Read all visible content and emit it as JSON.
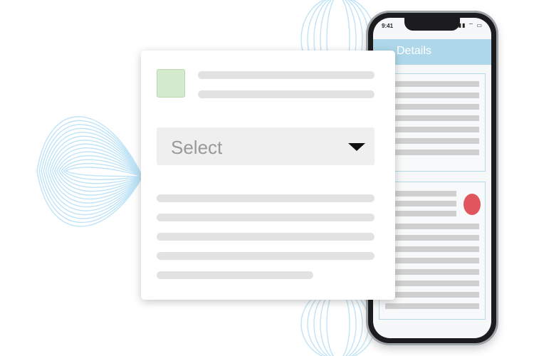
{
  "phone": {
    "status_time": "9:41",
    "status_icons": "▮▮ ⌔ ▭",
    "header_title": "Details"
  },
  "form": {
    "select_value": "Select"
  },
  "colors": {
    "accent_header": "#aed8ea",
    "thumbnail": "#d5ebcd",
    "marker": "#e0555e"
  },
  "icons": [
    "dropdown-arrow-icon",
    "signal-icon",
    "wifi-icon",
    "battery-icon"
  ]
}
